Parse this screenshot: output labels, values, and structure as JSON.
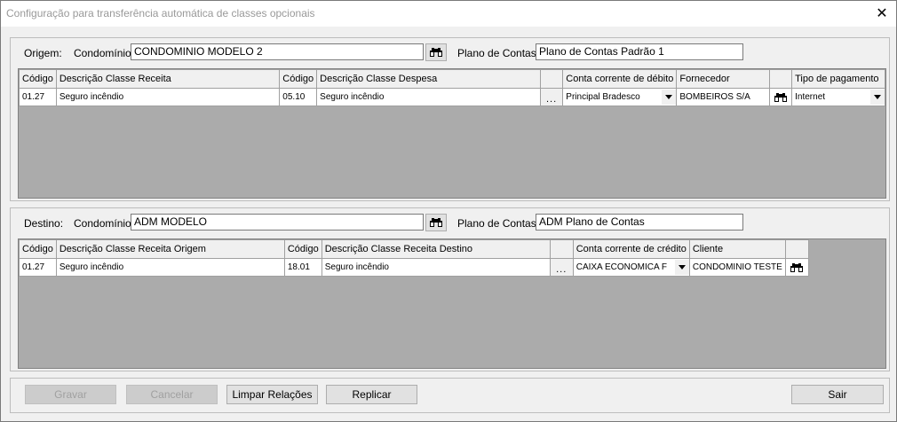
{
  "window": {
    "title": "Configuração para transferência automática de classes opcionais",
    "close": "✕"
  },
  "origem": {
    "label": "Origem:",
    "condominio_label": "Condomínio:",
    "condominio_value": "CONDOMINIO MODELO 2",
    "plano_label": "Plano de Contas:",
    "plano_value": "Plano de Contas Padrão 1",
    "headers": [
      "Código",
      "Descrição Classe Receita",
      "Código",
      "Descrição Classe Despesa",
      "",
      "Conta corrente de débito",
      "Fornecedor",
      "",
      "Tipo de pagamento"
    ],
    "rows": [
      {
        "codigo1": "01.27",
        "descricao1": "Seguro incêndio",
        "codigo2": "05.10",
        "descricao2": "Seguro incêndio",
        "btn": "...",
        "conta": "Principal Bradesco",
        "fornecedor": "BOMBEIROS S/A",
        "tipo": "Internet"
      }
    ]
  },
  "destino": {
    "label": "Destino:",
    "condominio_label": "Condomínio:",
    "condominio_value": "ADM MODELO",
    "plano_label": "Plano de Contas:",
    "plano_value": "ADM Plano de Contas",
    "headers": [
      "Código",
      "Descrição Classe Receita Origem",
      "Código",
      "Descrição Classe Receita Destino",
      "",
      "Conta corrente de crédito",
      "Cliente",
      ""
    ],
    "rows": [
      {
        "codigo1": "01.27",
        "descricao1": "Seguro incêndio",
        "codigo2": "18.01",
        "descricao2": "Seguro incêndio",
        "btn": "...",
        "conta": "CAIXA ECONOMICA F",
        "cliente": "CONDOMINIO TESTE"
      }
    ]
  },
  "buttons": {
    "gravar": "Gravar",
    "cancelar": "Cancelar",
    "limpar": "Limpar Relações",
    "replicar": "Replicar",
    "sair": "Sair"
  }
}
